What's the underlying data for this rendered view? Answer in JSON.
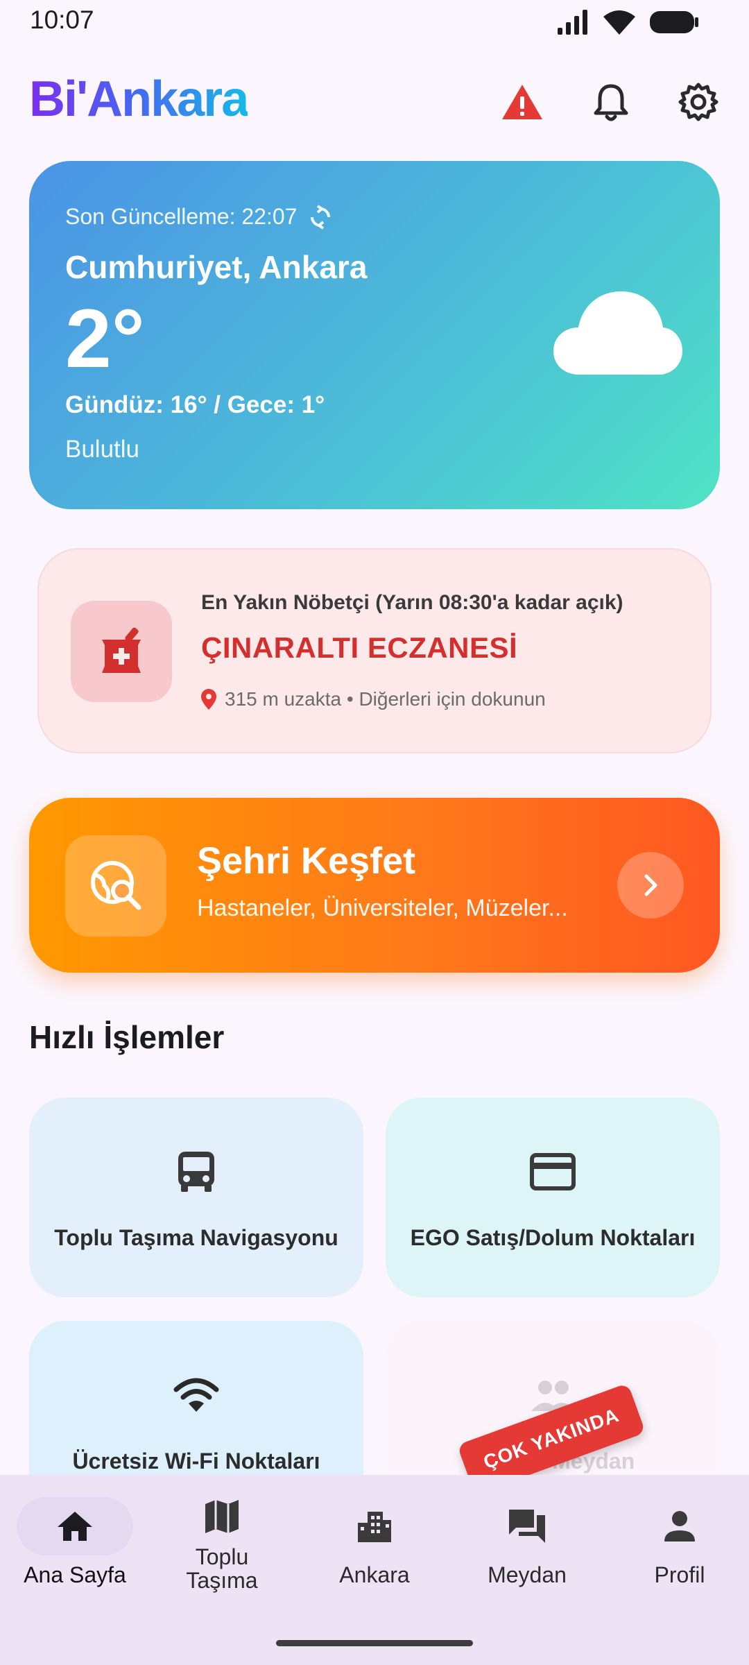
{
  "status_bar": {
    "time": "10:07"
  },
  "header": {
    "logo": "Bi'Ankara"
  },
  "weather": {
    "updated": "Son Güncelleme: 22:07",
    "location": "Cumhuriyet, Ankara",
    "temperature": "2°",
    "range": "Gündüz: 16° / Gece: 1°",
    "condition": "Bulutlu",
    "icon": "cloud-icon"
  },
  "pharmacy": {
    "subtitle": "En Yakın Nöbetçi (Yarın 08:30'a kadar açık)",
    "name": "ÇINARALTI ECZANESİ",
    "distance": "315 m uzakta • Diğerleri için dokunun",
    "accent": "#d32f2f"
  },
  "explore": {
    "title": "Şehri Keşfet",
    "subtitle": "Hastaneler, Üniversiteler, Müzeler...",
    "accent": "#ff7a1a"
  },
  "quick_actions": {
    "title": "Hızlı İşlemler",
    "items": [
      {
        "label": "Toplu Taşıma Navigasyonu",
        "icon": "bus-icon"
      },
      {
        "label": "EGO Satış/Dolum Noktaları",
        "icon": "card-icon"
      },
      {
        "label": "Ücretsiz Wi-Fi Noktaları",
        "icon": "wifi-icon"
      },
      {
        "label": "Ankara Meydan",
        "icon": "people-icon"
      }
    ],
    "badge": "ÇOK YAKINDA"
  },
  "bottom_nav": {
    "items": [
      {
        "label": "Ana Sayfa",
        "icon": "home-icon",
        "active": true
      },
      {
        "label": "Toplu\nTaşıma",
        "icon": "map-icon"
      },
      {
        "label": "Ankara",
        "icon": "city-icon"
      },
      {
        "label": "Meydan",
        "icon": "chat-icon"
      },
      {
        "label": "Profil",
        "icon": "person-icon"
      }
    ]
  }
}
